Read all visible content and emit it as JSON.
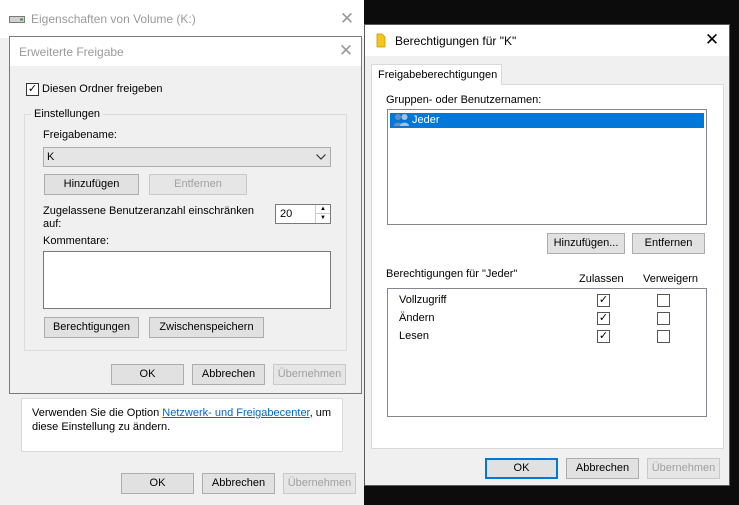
{
  "volume_props": {
    "title": "Eigenschaften von Volume (K:)",
    "info_text_before": "Verwenden Sie die Option ",
    "info_link": "Netzwerk- und Freigabecenter",
    "info_text_after": ", um",
    "info_text_line2": "diese Einstellung zu ändern.",
    "ok": "OK",
    "cancel": "Abbrechen",
    "apply": "Übernehmen"
  },
  "advanced_share": {
    "title": "Erweiterte Freigabe",
    "share_checkbox_label": "Diesen Ordner freigeben",
    "share_checked": true,
    "settings_group": "Einstellungen",
    "share_name_label": "Freigabename:",
    "share_name_value": "K",
    "add_button": "Hinzufügen",
    "remove_button": "Entfernen",
    "limit_label_line1": "Zugelassene Benutzeranzahl einschränken",
    "limit_label_line2": "auf:",
    "limit_value": "20",
    "comments_label": "Kommentare:",
    "comments_value": "",
    "permissions_button": "Berechtigungen",
    "caching_button": "Zwischenspeichern",
    "ok": "OK",
    "cancel": "Abbrechen",
    "apply": "Übernehmen"
  },
  "permissions": {
    "title": "Berechtigungen für \"K\"",
    "tab": "Freigabeberechtigungen",
    "groups_label": "Gruppen- oder Benutzernamen:",
    "groups": [
      {
        "name": "Jeder",
        "selected": true,
        "icon": "users-icon"
      }
    ],
    "add_button": "Hinzufügen...",
    "remove_button": "Entfernen",
    "perm_label": "Berechtigungen für \"Jeder\"",
    "allow_header": "Zulassen",
    "deny_header": "Verweigern",
    "rows": [
      {
        "name": "Vollzugriff",
        "allow": true,
        "deny": false
      },
      {
        "name": "Ändern",
        "allow": true,
        "deny": false
      },
      {
        "name": "Lesen",
        "allow": true,
        "deny": false
      }
    ],
    "ok": "OK",
    "cancel": "Abbrechen",
    "apply": "Übernehmen"
  },
  "colors": {
    "selection": "#0078d7",
    "link": "#0066cc",
    "folder": "#f5c518"
  }
}
